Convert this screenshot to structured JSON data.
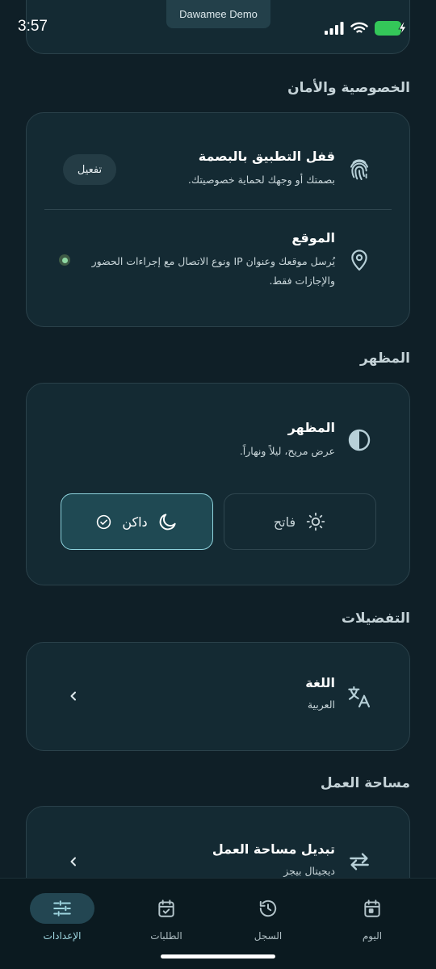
{
  "status_bar": {
    "time": "3:57",
    "demo_label": "Dawamee Demo",
    "battery_color": "#34c759"
  },
  "sections": {
    "privacy_title": "الخصوصية والأمان",
    "appearance_title": "المظهر",
    "preferences_title": "التفضيلات",
    "workspace_title": "مساحة العمل"
  },
  "privacy": {
    "biometric": {
      "icon": "fingerprint-icon",
      "title": "قفل التطبيق بالبصمة",
      "subtitle": "بصمتك أو وجهك لحماية خصوصيتك.",
      "button": "تفعيل"
    },
    "location": {
      "icon": "location-pin-icon",
      "title": "الموقع",
      "subtitle_line1": "يُرسل موقعك وعنوان IP ونوع الاتصال مع إجراءات الحضور",
      "subtitle_line2": "والإجازات فقط.",
      "status_color": "#8fd8a3"
    }
  },
  "appearance": {
    "icon": "contrast-icon",
    "title": "المظهر",
    "subtitle": "عرض مريح، ليلاً ونهاراً.",
    "light_label": "فاتح",
    "dark_label": "داكن",
    "selected": "dark",
    "accent_color": "#8ed3dd"
  },
  "preferences": {
    "language": {
      "icon": "translate-icon",
      "title": "اللغة",
      "value": "العربية"
    }
  },
  "workspace": {
    "switch": {
      "icon": "swap-arrows-icon",
      "title": "تبديل مساحة العمل",
      "value": "ديجيتال بيجز"
    }
  },
  "bottom_nav": {
    "items": [
      {
        "label": "الإعدادات",
        "icon": "sliders-icon",
        "active": true
      },
      {
        "label": "الطلبات",
        "icon": "calendar-check-icon",
        "active": false
      },
      {
        "label": "السجل",
        "icon": "history-icon",
        "active": false
      },
      {
        "label": "اليوم",
        "icon": "calendar-day-icon",
        "active": false
      }
    ]
  }
}
